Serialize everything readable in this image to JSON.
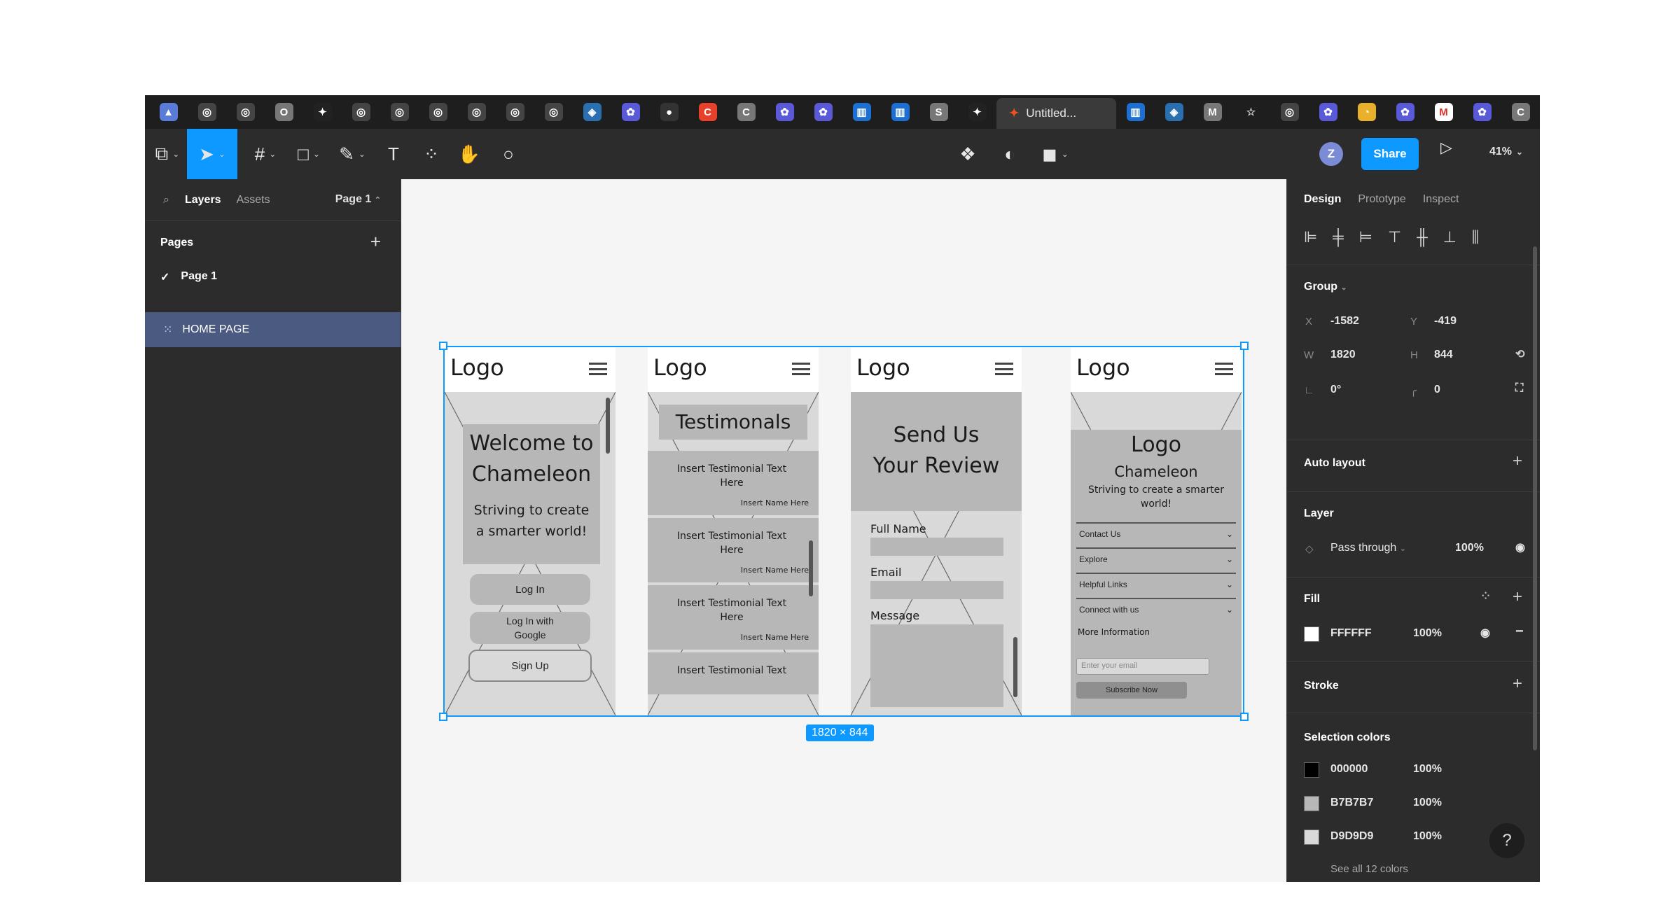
{
  "browser": {
    "active_tab_title": "Untitled...",
    "tab_icons": [
      "app-icon",
      "chrome-icon",
      "chrome-icon",
      "o-icon",
      "figma-icon",
      "chrome-icon",
      "chrome-icon",
      "chrome-icon",
      "chrome-icon",
      "chrome-icon",
      "chrome-icon",
      "extension-icon",
      "paw-icon",
      "github-icon",
      "c-red-icon",
      "c-icon",
      "paw-icon",
      "paw-icon",
      "trello-icon",
      "trello-icon",
      "s-icon",
      "figma-icon"
    ],
    "tab_icons_after": [
      "trello-icon",
      "extension-icon",
      "m-icon",
      "star-icon",
      "chrome-icon",
      "paw-icon",
      "google-icon",
      "paw-icon",
      "gmail-icon",
      "paw-icon",
      "c-icon"
    ]
  },
  "toolbar": {
    "avatar_letter": "Z",
    "share_label": "Share",
    "zoom": "41%"
  },
  "left_panel": {
    "tabs": [
      "Layers",
      "Assets"
    ],
    "page_selector": "Page 1",
    "pages_header": "Pages",
    "pages": [
      "Page 1"
    ],
    "layers": [
      "HOME PAGE"
    ]
  },
  "canvas": {
    "size_badge": "1820 × 844",
    "frames": {
      "home": {
        "logo": "Logo",
        "title_line1": "Welcome to",
        "title_line2": "Chameleon",
        "subtitle_line1": "Striving to create",
        "subtitle_line2": "a smarter world!",
        "login": "Log In",
        "login_google_line1": "Log In with",
        "login_google_line2": "Google",
        "signup": "Sign Up"
      },
      "testimonials": {
        "logo": "Logo",
        "title": "Testimonals",
        "items": [
          {
            "text_line1": "Insert Testimonial Text",
            "text_line2": "Here",
            "name": "Insert Name Here"
          },
          {
            "text_line1": "Insert Testimonial Text",
            "text_line2": "Here",
            "name": "Insert Name Here"
          },
          {
            "text_line1": "Insert Testimonial Text",
            "text_line2": "Here",
            "name": "Insert Name Here"
          },
          {
            "text_line1": "Insert Testimonial Text",
            "text_line2": "",
            "name": ""
          }
        ]
      },
      "review": {
        "logo": "Logo",
        "title_line1": "Send Us",
        "title_line2": "Your Review",
        "full_name": "Full Name",
        "email": "Email",
        "message": "Message"
      },
      "footer": {
        "logo": "Logo",
        "inner_logo": "Logo",
        "brand": "Chameleon",
        "tagline_line1": "Striving to create a smarter",
        "tagline_line2": "world!",
        "links": [
          "Contact Us",
          "Explore",
          "Helpful Links",
          "Connect with us"
        ],
        "more": "More Information",
        "email_placeholder": "Enter your email",
        "subscribe": "Subscribe Now"
      }
    }
  },
  "right_panel": {
    "tabs": [
      "Design",
      "Prototype",
      "Inspect"
    ],
    "group_label": "Group",
    "x_label": "X",
    "x_value": "-1582",
    "y_label": "Y",
    "y_value": "-419",
    "w_label": "W",
    "w_value": "1820",
    "h_label": "H",
    "h_value": "844",
    "rotation": "0°",
    "radius": "0",
    "auto_layout": "Auto layout",
    "layer_title": "Layer",
    "blend_mode": "Pass through",
    "layer_opacity": "100%",
    "fill_title": "Fill",
    "fill_hex": "FFFFFF",
    "fill_opacity": "100%",
    "stroke_title": "Stroke",
    "selection_title": "Selection colors",
    "selection_colors": [
      {
        "hex": "000000",
        "opacity": "100%",
        "color": "#000000"
      },
      {
        "hex": "B7B7B7",
        "opacity": "100%",
        "color": "#b7b7b7"
      },
      {
        "hex": "D9D9D9",
        "opacity": "100%",
        "color": "#d9d9d9"
      }
    ],
    "see_all": "See all 12 colors",
    "help": "?"
  },
  "colors": {
    "accent": "#0d99ff",
    "panel": "#2c2c2c",
    "selected_layer": "#4a5a80"
  }
}
